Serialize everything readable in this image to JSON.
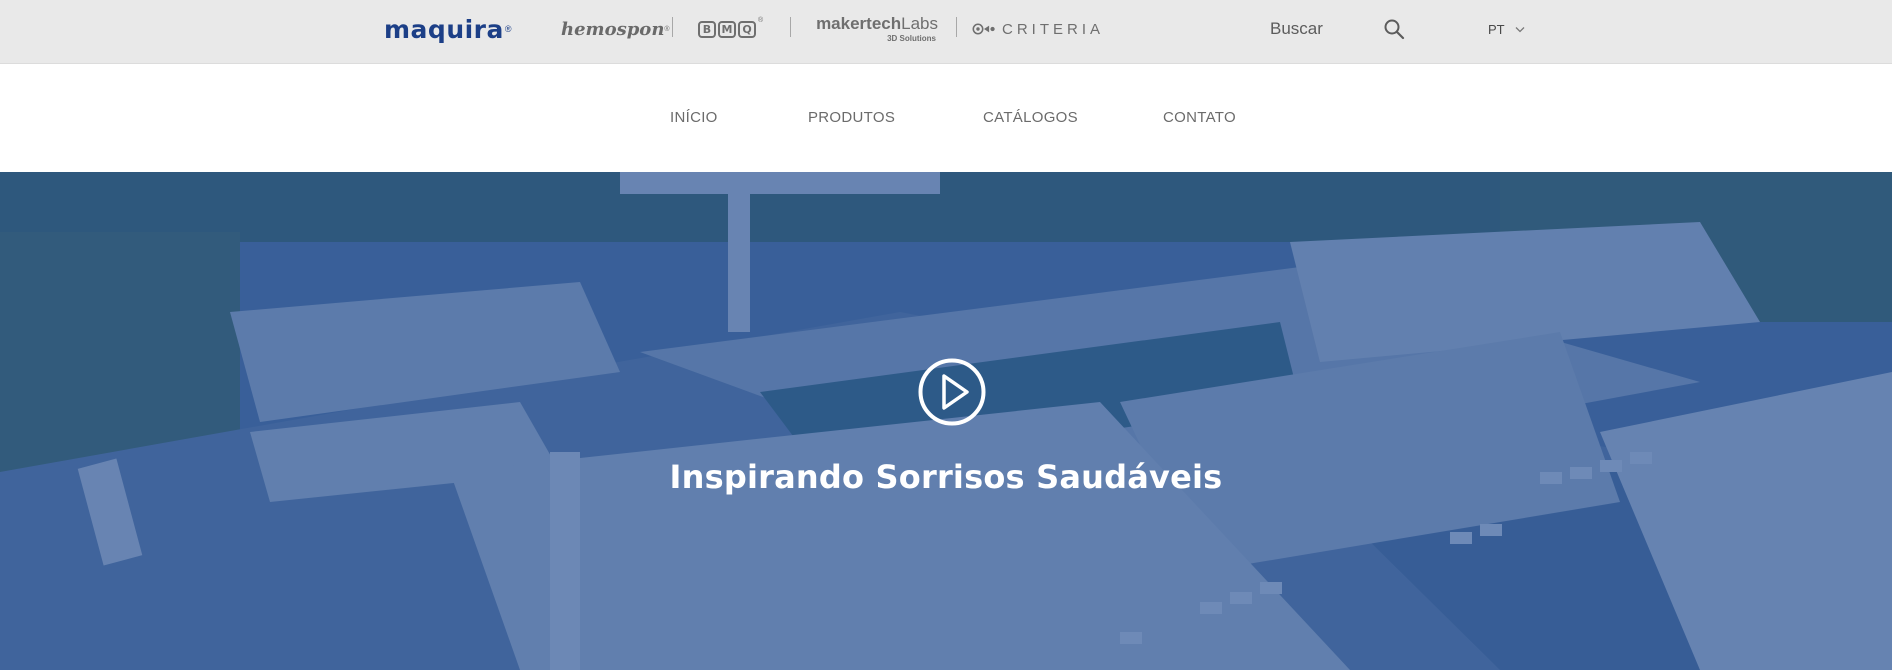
{
  "brands": {
    "maquira": "maquira",
    "hemospon": "hemospon",
    "bmq_letters": [
      "B",
      "M",
      "Q"
    ],
    "makertech_bold": "makertech",
    "makertech_thin": "Labs",
    "makertech_sub": "3D Solutions",
    "criteria": "CRITERIA",
    "registered": "®"
  },
  "search": {
    "label": "Buscar",
    "icon": "search-icon"
  },
  "language": {
    "code": "PT",
    "icon": "chevron-down-icon"
  },
  "nav": {
    "inicio": "INÍCIO",
    "produtos": "PRODUTOS",
    "catalogos": "CATÁLOGOS",
    "contato": "CONTATO"
  },
  "hero": {
    "title": "Inspirando Sorrisos Saudáveis",
    "play_icon": "play-icon"
  },
  "colors": {
    "topbar_bg": "#e9e9e9",
    "brand_blue": "#1c3f87",
    "overlay_blue": "#234e91",
    "nav_text": "#6b6b6b"
  }
}
